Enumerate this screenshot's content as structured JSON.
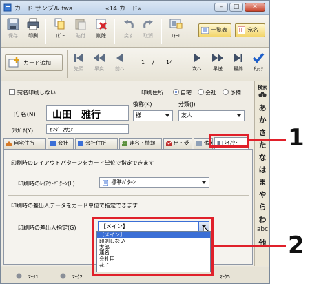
{
  "window": {
    "title": "カード サンプル.fwa",
    "title_center": "«14 カード»",
    "btn_min": "–",
    "btn_max": "□",
    "btn_close": "✕"
  },
  "toolbar": {
    "items": [
      {
        "label": "保存",
        "enabled": false,
        "icon": "floppy-icon"
      },
      {
        "label": "印刷",
        "enabled": true,
        "icon": "printer-icon"
      },
      {
        "label": "ｺﾋﾟｰ",
        "enabled": true,
        "icon": "copy-icon"
      },
      {
        "label": "貼付",
        "enabled": false,
        "icon": "paste-icon"
      },
      {
        "label": "削除",
        "enabled": true,
        "icon": "delete-icon"
      },
      {
        "label": "戻す",
        "enabled": false,
        "icon": "undo-icon"
      },
      {
        "label": "取消",
        "enabled": false,
        "icon": "redo-icon"
      },
      {
        "label": "ﾌｫｰﾑ",
        "enabled": true,
        "icon": "form-icon"
      }
    ],
    "list_view": "一覧表",
    "address": "宛名"
  },
  "navbar": {
    "add_card": "カード追加",
    "first": "先頭",
    "fast_back": "早戻",
    "prev": "前へ",
    "page_current": "1",
    "page_sep": "/",
    "page_total": "14",
    "next": "次へ",
    "fast_fwd": "早送",
    "last": "最終",
    "check": "ﾁｪｯｸ"
  },
  "form": {
    "no_address_print": "宛名印刷しない",
    "print_address_label": "印刷住所",
    "radio_home": "自宅",
    "radio_company": "会社",
    "radio_spare": "予備",
    "name_label": "氏 名(N)",
    "name_value": "山田　雅行",
    "honorific_label": "敬称(K)",
    "honorific_value": "様",
    "category_label": "分類(J)",
    "category_value": "友人",
    "furigana_label": "ﾌﾘｶﾞﾅ(Y)",
    "furigana_value": "ﾔﾏﾀﾞ ﾏｻﾕｷ"
  },
  "tabs": [
    {
      "label": "自宅住所",
      "active": false
    },
    {
      "label": "会社",
      "active": false
    },
    {
      "label": "会社住所",
      "active": false
    },
    {
      "label": "連名・情報",
      "active": false
    },
    {
      "label": "出・受",
      "active": false
    },
    {
      "label": "備考",
      "active": false
    },
    {
      "label": "ﾚｲｱｳﾄ",
      "active": true
    }
  ],
  "layout_panel": {
    "desc1": "印刷時のレイアウトパターンをカード単位で指定できます",
    "layout_label": "印刷時のﾚｲｱｳﾄﾊﾟﾀｰﾝ(L)",
    "layout_value": "標準ﾊﾟﾀｰﾝ",
    "desc2": "印刷時の差出人データをカード単位で指定できます",
    "sender_label": "印刷時の差出人指定(G)",
    "sender_value": "【メイン】",
    "sender_options": [
      "【メイン】",
      "印刷しない",
      "太郎",
      "連名",
      "会社用",
      "花子"
    ]
  },
  "sidebar": {
    "search": "検索",
    "kana": [
      "あ",
      "か",
      "さ",
      "た",
      "な",
      "は",
      "ま",
      "や",
      "ら",
      "わ"
    ],
    "abc": "abc",
    "other": "他"
  },
  "status": {
    "marks": [
      "ﾏｰｸ1",
      "ﾏｰｸ2",
      "ﾏｰｸ5"
    ]
  },
  "annotations": {
    "callout1": "1",
    "callout2": "2"
  },
  "colors": {
    "highlight": "#e0202a",
    "selection": "#3b6fd6"
  }
}
